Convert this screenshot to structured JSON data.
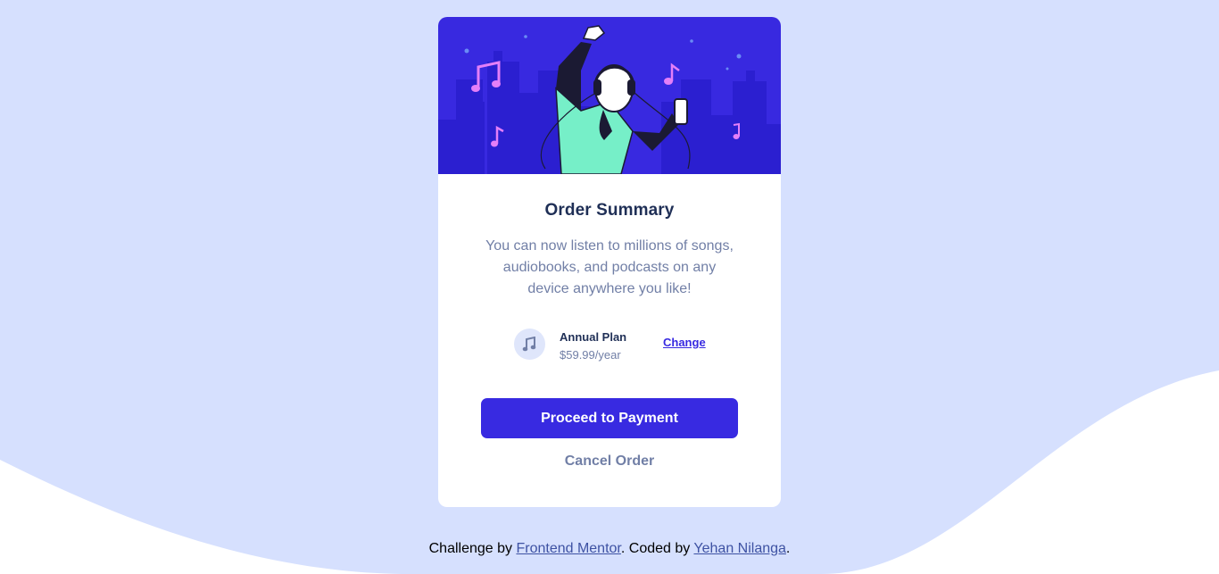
{
  "card": {
    "title": "Order Summary",
    "description": "You can now listen to millions of songs, audiobooks, and podcasts on any device anywhere you like!",
    "plan": {
      "icon": "music-note-icon",
      "name": "Annual Plan",
      "price": "$59.99/year",
      "change_label": "Change"
    },
    "primary_button": "Proceed to Payment",
    "secondary_button": "Cancel Order"
  },
  "footer": {
    "prefix": "Challenge by ",
    "link1": "Frontend Mentor",
    "middle": ". Coded by ",
    "link2": "Yehan Nilanga",
    "suffix": "."
  },
  "colors": {
    "background": "#d6e0fe",
    "wave": "#ffffff",
    "accent": "#382ae1",
    "title": "#1f2f56",
    "muted": "#717fa6"
  }
}
